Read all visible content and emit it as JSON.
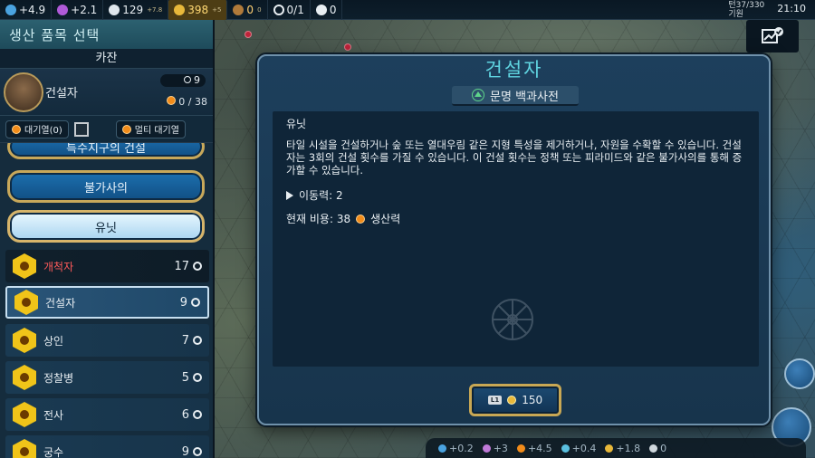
{
  "topbar": {
    "science": "+4.9",
    "culture": "+2.1",
    "faith": "129",
    "faith_sup": "+7.8",
    "gold": "398",
    "gold_sup": "+5",
    "tourism": "0",
    "tourism_sup": "0",
    "envoys": "0/1",
    "governor": "0",
    "turn_label": "턴",
    "turn_value": "37/330",
    "era_label": "기원",
    "time": "21:10"
  },
  "left_panel": {
    "title": "생산 품목 선택",
    "city": "카잔",
    "current": {
      "name": "건설자",
      "turns": "9",
      "progress": "0 / 38"
    },
    "queue_label": "대기열(0)",
    "multi_queue_label": "멀티 대기열",
    "partial_category": "특수지구의 건설",
    "categories": [
      "불가사의",
      "유닛"
    ],
    "units": [
      {
        "name": "개척자",
        "turns": "17"
      },
      {
        "name": "건설자",
        "turns": "9"
      },
      {
        "name": "상인",
        "turns": "7"
      },
      {
        "name": "정찰병",
        "turns": "5"
      },
      {
        "name": "전사",
        "turns": "6"
      },
      {
        "name": "궁수",
        "turns": "9"
      }
    ]
  },
  "modal": {
    "title": "건설자",
    "pedia_label": "문명 백과사전",
    "type": "유닛",
    "description": "타일 시설을 건설하거나 숲 또는 열대우림 같은 지형 특성을 제거하거나, 자원을 수확할 수 있습니다. 건설자는 3회의 건설 횟수를 가질 수 있습니다. 이 건설 횟수는 정책 또는 피라미드와 같은 불가사의를 통해 증가할 수 있습니다.",
    "movement": "이동력: 2",
    "cost_text": "현재 비용: 38",
    "cost_unit": "생산력",
    "buy_button_key": "L1",
    "buy_price": "150"
  },
  "yields": [
    {
      "value": "+0.2",
      "color": "#4aa3e0"
    },
    {
      "value": "+3",
      "color": "#c07ad8"
    },
    {
      "value": "+4.5",
      "color": "#f28c1a"
    },
    {
      "value": "+0.4",
      "color": "#5ac0e0"
    },
    {
      "value": "+1.8",
      "color": "#e8b83a"
    },
    {
      "value": "0",
      "color": "#d0d8dd"
    }
  ]
}
